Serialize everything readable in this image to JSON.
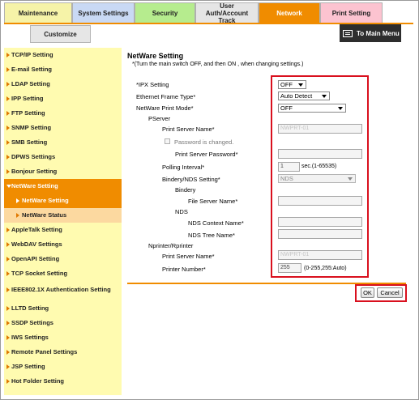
{
  "tabs": [
    {
      "label": "Maintenance",
      "color": "#f6f3a8"
    },
    {
      "label": "System Settings",
      "color": "#c9d9f4"
    },
    {
      "label": "Security",
      "color": "#b6ec8e"
    },
    {
      "label": "User Auth/Account Track",
      "color": "#e5e5e5"
    },
    {
      "label": "Network",
      "color": "#f08c00"
    },
    {
      "label": "Print Setting",
      "color": "#fcc3d0"
    }
  ],
  "sub_tab": "Customize",
  "to_main_menu": "To Main Menu",
  "sidebar": {
    "items": [
      {
        "label": "TCP/IP Setting"
      },
      {
        "label": "E-mail Setting"
      },
      {
        "label": "LDAP Setting"
      },
      {
        "label": "IPP Setting"
      },
      {
        "label": "FTP Setting"
      },
      {
        "label": "SNMP Setting"
      },
      {
        "label": "SMB Setting"
      },
      {
        "label": "DPWS Settings"
      },
      {
        "label": "Bonjour Setting"
      },
      {
        "label": "NetWare Setting"
      },
      {
        "label": "NetWare Setting"
      },
      {
        "label": "NetWare Status"
      },
      {
        "label": "AppleTalk Setting"
      },
      {
        "label": "WebDAV Settings"
      },
      {
        "label": "OpenAPI Setting"
      },
      {
        "label": "TCP Socket Setting"
      },
      {
        "label": "IEEE802.1X Authentication Setting"
      },
      {
        "label": "LLTD Setting"
      },
      {
        "label": "SSDP Settings"
      },
      {
        "label": "IWS Settings"
      },
      {
        "label": "Remote Panel Settings"
      },
      {
        "label": "JSP Setting"
      },
      {
        "label": "Hot Folder Setting"
      }
    ]
  },
  "main": {
    "title": "NetWare Setting",
    "note": "*(Turn the main switch OFF, and then ON , when changing settings.)",
    "ipx_label": "*IPX Setting",
    "ipx_value": "OFF",
    "frame_type_label": "Ethernet Frame Type*",
    "frame_type_value": "Auto Detect",
    "print_mode_label": "NetWare Print Mode*",
    "print_mode_value": "OFF",
    "pserver_label": "PServer",
    "ps_name_label": "Print Server Name*",
    "ps_name_value": "NWPRT-01",
    "pw_changed_label": "Password is changed.",
    "ps_password_label": "Print Server Password*",
    "ps_password_value": "",
    "polling_label": "Polling Interval*",
    "polling_value": "1",
    "polling_unit": "sec.(1-65535)",
    "bindery_nds_label": "Bindery/NDS Setting*",
    "bindery_nds_value": "NDS",
    "bindery_label": "Bindery",
    "file_server_label": "File Server Name*",
    "file_server_value": "",
    "nds_label": "NDS",
    "nds_context_label": "NDS Context Name*",
    "nds_context_value": "",
    "nds_tree_label": "NDS Tree Name*",
    "nds_tree_value": "",
    "nprinter_label": "Nprinter/Rprinter",
    "nps_name_label": "Print Server Name*",
    "nps_name_value": "NWPRT-01",
    "printer_number_label": "Printer Number*",
    "printer_number_value": "255",
    "printer_number_unit": "(0-255,255:Auto)",
    "ok_label": "OK",
    "cancel_label": "Cancel"
  },
  "colors": {
    "accent": "#f08c00",
    "sidebar_bg": "#fffbb0",
    "highlight_box": "#d9101e"
  }
}
